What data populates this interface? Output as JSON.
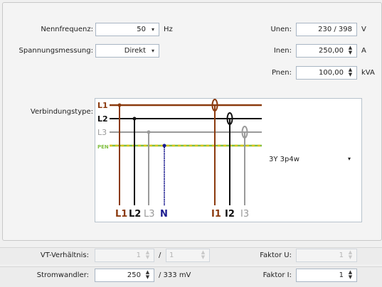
{
  "settings": {
    "nennfrequenz": {
      "label": "Nennfrequenz:",
      "value": "50",
      "unit": "Hz"
    },
    "spannungsmessung": {
      "label": "Spannungsmessung:",
      "value": "Direkt"
    },
    "unen": {
      "label": "Unen:",
      "value": "230 / 398",
      "unit": "V"
    },
    "inen": {
      "label": "Inen:",
      "value": "250,00",
      "unit": "A"
    },
    "pnen": {
      "label": "Pnen:",
      "value": "100,00",
      "unit": "kVA"
    }
  },
  "verbindung": {
    "label": "Verbindungstype:",
    "selected": "3Y  3p4w",
    "line_labels": [
      "L1",
      "L2",
      "L3",
      "PEN"
    ],
    "bottom_labels": [
      "L1",
      "L2",
      "L3",
      "N",
      "I1",
      "I2",
      "I3"
    ],
    "colors": {
      "L1": "#8b3a0e",
      "L2": "#111111",
      "L3": "#9a9a9a",
      "N": "#1b1b8f",
      "PEN_green": "#7fbf3f",
      "PEN_yellow": "#d8c41c"
    }
  },
  "vt": {
    "label": "VT-Verhältnis:",
    "primary": "1",
    "secondary": "1",
    "separator": "/",
    "faktor_u_label": "Faktor U:",
    "faktor_u": "1"
  },
  "stromwandler": {
    "label": "Stromwandler:",
    "value": "250",
    "ratio": "/ 333 mV",
    "faktor_i_label": "Faktor I:",
    "faktor_i": "1"
  },
  "icons": {
    "dropdown": "▾",
    "spin_up": "▲",
    "spin_down": "▼"
  }
}
